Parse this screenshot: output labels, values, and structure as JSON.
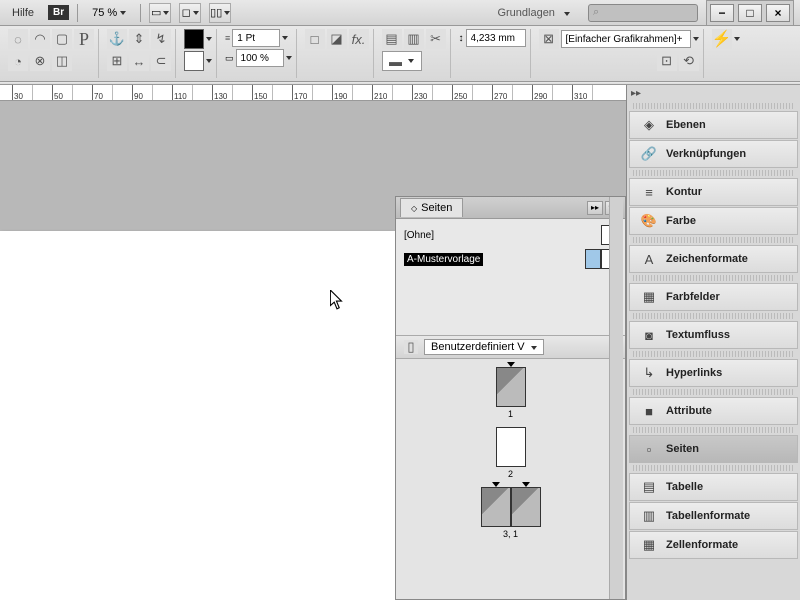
{
  "menubar": {
    "help": "Hilfe",
    "br": "Br",
    "zoom": "75 %",
    "workspace": "Grundlagen"
  },
  "window_controls": {
    "min": "−",
    "max": "□",
    "close": "×"
  },
  "toolbar": {
    "stroke": "1 Pt",
    "opacity": "100 %",
    "dim": "4,233 mm",
    "frame_preset": "[Einfacher Grafikrahmen]+"
  },
  "ruler": {
    "marks": [
      "30",
      "50",
      "70",
      "90",
      "110",
      "130",
      "150",
      "170",
      "190",
      "210",
      "230",
      "250",
      "270",
      "290",
      "310"
    ]
  },
  "pages_panel": {
    "title": "Seiten",
    "masters": {
      "none": "[Ohne]",
      "a": "A-Mustervorlage"
    },
    "spread_preset": "Benutzerdefiniert V",
    "pages": [
      "1",
      "2",
      "3, 1"
    ]
  },
  "side": {
    "items": [
      {
        "icon": "◈",
        "label": "Ebenen"
      },
      {
        "icon": "🔗",
        "label": "Verknüpfungen"
      },
      {
        "icon": "≡",
        "label": "Kontur"
      },
      {
        "icon": "🎨",
        "label": "Farbe"
      },
      {
        "icon": "A",
        "label": "Zeichenformate"
      },
      {
        "icon": "▦",
        "label": "Farbfelder"
      },
      {
        "icon": "◙",
        "label": "Textumfluss"
      },
      {
        "icon": "↳",
        "label": "Hyperlinks"
      },
      {
        "icon": "■",
        "label": "Attribute"
      },
      {
        "icon": "▫",
        "label": "Seiten"
      },
      {
        "icon": "▤",
        "label": "Tabelle"
      },
      {
        "icon": "▥",
        "label": "Tabellenformate"
      },
      {
        "icon": "▦",
        "label": "Zellenformate"
      }
    ]
  }
}
